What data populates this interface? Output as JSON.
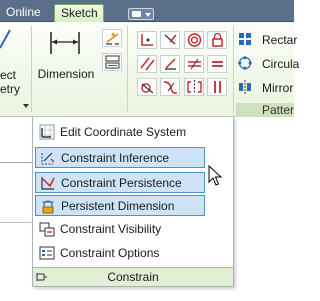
{
  "tabs": {
    "online": "Online",
    "sketch": "Sketch"
  },
  "left_panel": {
    "line1": "ect",
    "line2": "etry"
  },
  "dimension": {
    "label": "Dimension"
  },
  "pattern_panel": {
    "items": [
      "Rectar",
      "Circula",
      "Mirror"
    ],
    "title": "Patter"
  },
  "menu": {
    "items": [
      {
        "label": "Edit Coordinate System",
        "icon": "coordinate-system-icon",
        "checked": false
      },
      {
        "label": "Constraint Inference",
        "icon": "constraint-inference-icon",
        "checked": true
      },
      {
        "label": "Constraint Persistence",
        "icon": "constraint-persistence-icon",
        "checked": true
      },
      {
        "label": "Persistent Dimension",
        "icon": "persistent-dimension-icon",
        "checked": true
      },
      {
        "label": "Constraint Visibility",
        "icon": "constraint-visibility-icon",
        "checked": false
      },
      {
        "label": "Constraint Options",
        "icon": "constraint-options-icon",
        "checked": false
      }
    ],
    "footer": "Constrain"
  },
  "colors": {
    "tab_bar": "#5a6f89",
    "ribbon_green": "#eaf3df",
    "checked_fill": "#cfe3f7",
    "checked_border": "#4e8fd3",
    "constraint_red": "#c42a2a"
  }
}
